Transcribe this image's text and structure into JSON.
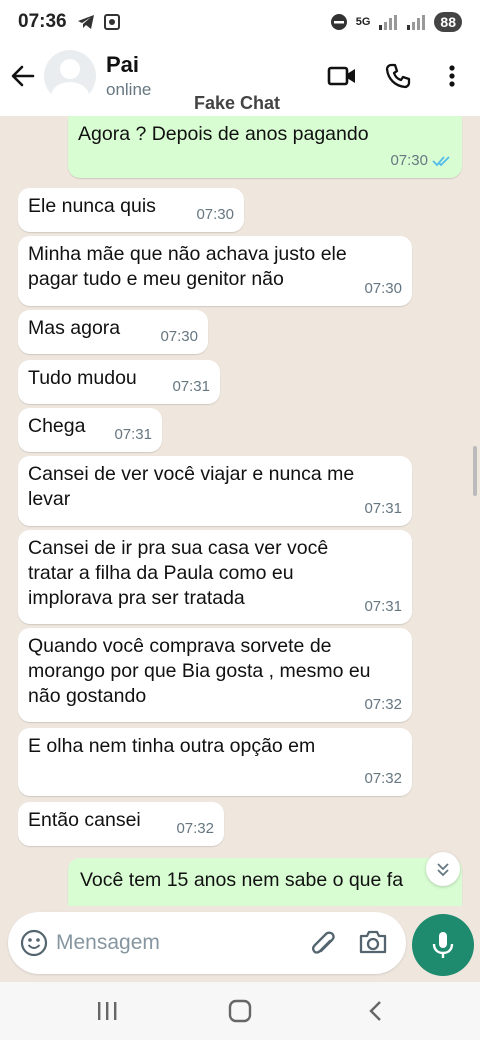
{
  "status_bar": {
    "time": "07:36",
    "network": "5G",
    "battery": "88"
  },
  "header": {
    "contact_name": "Pai",
    "contact_status": "online",
    "watermark": "Fake Chat"
  },
  "colors": {
    "outgoing": "#d9fdd3",
    "incoming": "#ffffff",
    "background": "#efe7de",
    "accent": "#1e8a6e",
    "read_ticks": "#53bdeb"
  },
  "messages": [
    {
      "dir": "out",
      "text": "Agora ? Depois de anos pagando",
      "time": "07:30",
      "read": true
    },
    {
      "dir": "in",
      "text": "Ele nunca quis",
      "time": "07:30"
    },
    {
      "dir": "in",
      "text": "Minha mãe que não achava justo ele pagar tudo e meu genitor não",
      "time": "07:30"
    },
    {
      "dir": "in",
      "text": "Mas agora",
      "time": "07:30"
    },
    {
      "dir": "in",
      "text": "Tudo mudou",
      "time": "07:31"
    },
    {
      "dir": "in",
      "text": "Chega",
      "time": "07:31"
    },
    {
      "dir": "in",
      "text": "Cansei de ver você viajar e nunca me levar",
      "time": "07:31"
    },
    {
      "dir": "in",
      "text": "Cansei de ir pra sua casa ver você tratar a filha da Paula como eu implorava pra ser tratada",
      "time": "07:31"
    },
    {
      "dir": "in",
      "text": "Quando você comprava sorvete de morango por que Bia gosta , mesmo eu não gostando",
      "time": "07:32"
    },
    {
      "dir": "in",
      "text": "E olha nem tinha outra opção em",
      "time": "07:32"
    },
    {
      "dir": "in",
      "text": "Então cansei",
      "time": "07:32"
    },
    {
      "dir": "out",
      "text": "Você tem 15 anos nem sabe o que fa",
      "time": ""
    }
  ],
  "composer": {
    "placeholder": "Mensagem"
  },
  "icons": {
    "back": "arrow-left-icon",
    "video": "video-call-icon",
    "call": "phone-icon",
    "menu": "more-vert-icon",
    "emoji": "emoji-icon",
    "attach": "paperclip-icon",
    "camera": "camera-icon",
    "mic": "microphone-icon",
    "scroll": "scroll-down-icon"
  }
}
